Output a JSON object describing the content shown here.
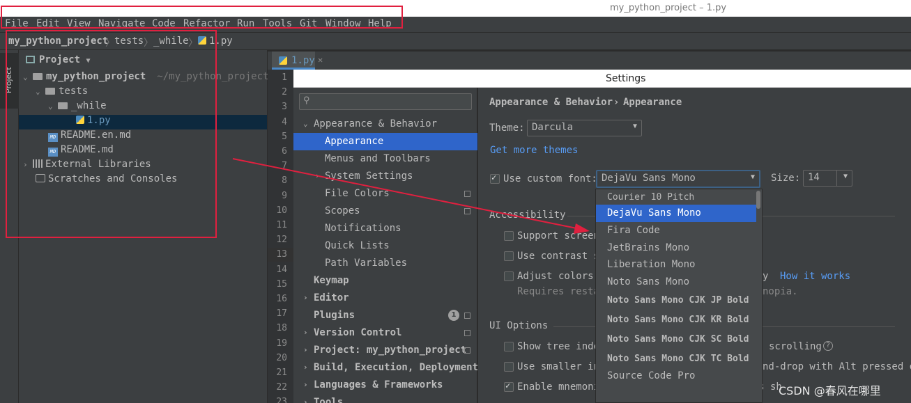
{
  "window": {
    "title": "my_python_project – 1.py"
  },
  "menu": [
    "File",
    "Edit",
    "View",
    "Navigate",
    "Code",
    "Refactor",
    "Run",
    "Tools",
    "Git",
    "Window",
    "Help"
  ],
  "breadcrumb": [
    "my_python_project",
    "tests",
    "_while",
    "1.py"
  ],
  "toolstrip": {
    "project_tab": "Project"
  },
  "project_panel": {
    "header": "Project",
    "root": {
      "label": "my_python_project",
      "path": "~/my_python_project"
    },
    "tests": "tests",
    "while": "_while",
    "file": "1.py",
    "readme_en": "README.en.md",
    "readme": "README.md",
    "external": "External Libraries",
    "scratches": "Scratches and Consoles"
  },
  "editor": {
    "tab": "1.py",
    "line_numbers": [
      "1",
      "2",
      "3",
      "4",
      "5",
      "6",
      "7",
      "8",
      "9",
      "10",
      "11",
      "12",
      "13",
      "14",
      "15",
      "16",
      "17",
      "18",
      "19",
      "20",
      "21",
      "22",
      "23"
    ]
  },
  "settings": {
    "title": "Settings",
    "nav": {
      "appearance_behavior": "Appearance & Behavior",
      "appearance": "Appearance",
      "menus_toolbars": "Menus and Toolbars",
      "system_settings": "System Settings",
      "file_colors": "File Colors",
      "scopes": "Scopes",
      "notifications": "Notifications",
      "quick_lists": "Quick Lists",
      "path_variables": "Path Variables",
      "keymap": "Keymap",
      "editor": "Editor",
      "plugins": "Plugins",
      "plugins_count": "1",
      "version_control": "Version Control",
      "project": "Project: my_python_project",
      "build": "Build, Execution, Deployment",
      "languages": "Languages & Frameworks",
      "tools": "Tools"
    },
    "content": {
      "crumb_parent": "Appearance & Behavior",
      "crumb_sep": "›",
      "crumb_current": "Appearance",
      "theme_label": "Theme:",
      "theme_value": "Darcula",
      "more_themes": "Get more themes",
      "custom_font_label": "Use custom font:",
      "custom_font_checked": true,
      "font_value": "DejaVu Sans Mono",
      "size_label": "Size:",
      "size_value": "14",
      "accessibility": "Accessibility",
      "support_screen": "Support screen",
      "use_contrast": "Use contrast s",
      "adjust_colors": "Adjust colors",
      "adjust_tail": "y",
      "how_it_works": "How it works",
      "requires": "Requires resta",
      "requires_tail": "nopia.",
      "ui_options": "UI Options",
      "show_tree": "Show tree inde",
      "show_tree_tail": "scrolling",
      "use_smaller": "Use smaller in",
      "use_smaller_tail": "nd-drop with Alt pressed or",
      "enable_mnemonics": "Enable mnemonics in menu",
      "always_show": "Always sh"
    },
    "font_options": [
      {
        "label": "Courier 10 Pitch",
        "selected": false,
        "bold": false
      },
      {
        "label": "DejaVu Sans Mono",
        "selected": true,
        "bold": false
      },
      {
        "label": "Fira Code",
        "selected": false,
        "bold": false
      },
      {
        "label": "JetBrains Mono",
        "selected": false,
        "bold": false
      },
      {
        "label": "Liberation Mono",
        "selected": false,
        "bold": false
      },
      {
        "label": "Noto Sans Mono",
        "selected": false,
        "bold": false
      },
      {
        "label": "Noto Sans Mono CJK JP Bold",
        "selected": false,
        "bold": true
      },
      {
        "label": "Noto Sans Mono CJK KR Bold",
        "selected": false,
        "bold": true
      },
      {
        "label": "Noto Sans Mono CJK SC Bold",
        "selected": false,
        "bold": true
      },
      {
        "label": "Noto Sans Mono CJK TC Bold",
        "selected": false,
        "bold": true
      },
      {
        "label": "Source Code Pro",
        "selected": false,
        "bold": false
      }
    ]
  },
  "watermark": "CSDN @春风在哪里",
  "colors": {
    "accent": "#2f65ca",
    "annotation": "#e0203f",
    "link": "#589df6"
  }
}
